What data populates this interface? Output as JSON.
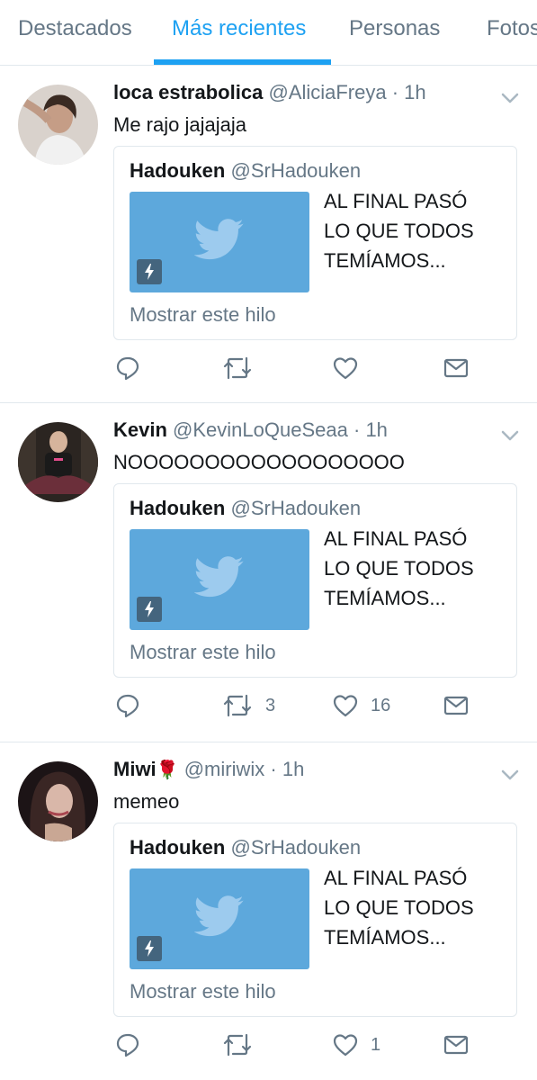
{
  "tabs": [
    {
      "label": "Destacados"
    },
    {
      "label": "Más recientes",
      "active": true
    },
    {
      "label": "Personas"
    },
    {
      "label": "Fotos"
    }
  ],
  "colors": {
    "accent": "#1da1f2",
    "secondary_text": "#657786",
    "card_media": "#5da8dc"
  },
  "tweets": [
    {
      "name": "loca estrabolica",
      "name_emoji": "",
      "handle": "@AliciaFreya",
      "separator": "·",
      "time": "1h",
      "text": "Me rajo jajajaja",
      "card": {
        "author": "Hadouken",
        "handle": "@SrHadouken",
        "title_lines": [
          "AL FINAL PASÓ",
          "LO QUE TODOS",
          "TEMÍAMOS..."
        ],
        "footer": "Mostrar este hilo"
      },
      "retweets": "",
      "likes": ""
    },
    {
      "name": "Kevin",
      "name_emoji": "",
      "handle": "@KevinLoQueSeaa",
      "separator": "·",
      "time": "1h",
      "text": "NOOOOOOOOOOOOOOOOOO",
      "card": {
        "author": "Hadouken",
        "handle": "@SrHadouken",
        "title_lines": [
          "AL FINAL PASÓ",
          "LO QUE TODOS",
          "TEMÍAMOS..."
        ],
        "footer": "Mostrar este hilo"
      },
      "retweets": "3",
      "likes": "16"
    },
    {
      "name": "Miwi",
      "name_emoji": "🌹",
      "handle": "@miriwix",
      "separator": "·",
      "time": "1h",
      "text": "memeo",
      "card": {
        "author": "Hadouken",
        "handle": "@SrHadouken",
        "title_lines": [
          "AL FINAL PASÓ",
          "LO QUE TODOS",
          "TEMÍAMOS..."
        ],
        "footer": "Mostrar este hilo"
      },
      "retweets": "",
      "likes": "1"
    }
  ]
}
